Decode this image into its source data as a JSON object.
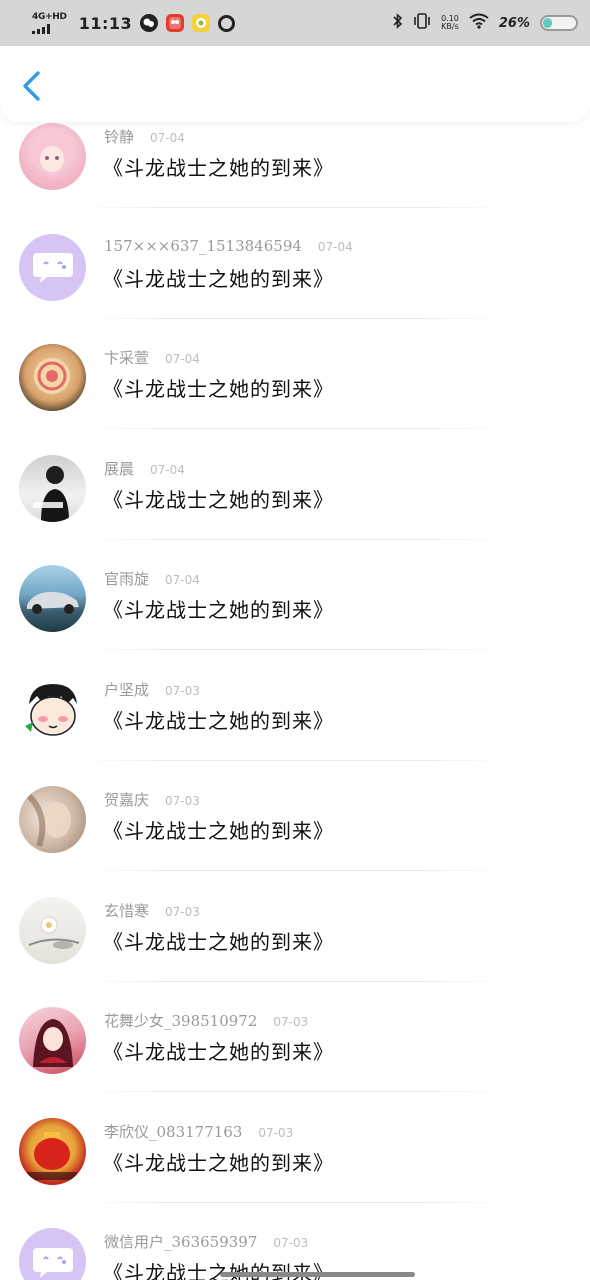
{
  "status_bar": {
    "network": "4G+HD",
    "time": "11:13",
    "net_speed_value": "0.10",
    "net_speed_unit": "KB/s",
    "battery_percent": "26%",
    "battery_level": 0.26,
    "app_icons": [
      "wechat-icon",
      "app-badge-icon",
      "app-yellow-icon",
      "q-icon"
    ]
  },
  "nav": {
    "back_icon": "chevron-left-icon",
    "accent_color": "#2f9be6"
  },
  "rows": [
    {
      "name": "铃静",
      "date": "07-04",
      "title": "《斗龙战士之她的到来》",
      "avatar": "anime-girl-avatar"
    },
    {
      "name": "157×××637_1513846594",
      "date": "07-04",
      "title": "《斗龙战士之她的到来》",
      "avatar": "default-chat-avatar"
    },
    {
      "name": "卞采萱",
      "date": "07-04",
      "title": "《斗龙战士之她的到来》",
      "avatar": "melon-avatar"
    },
    {
      "name": "展晨",
      "date": "07-04",
      "title": "《斗龙战士之她的到来》",
      "avatar": "person-photo-avatar"
    },
    {
      "name": "官雨旋",
      "date": "07-04",
      "title": "《斗龙战士之她的到来》",
      "avatar": "car-avatar"
    },
    {
      "name": "户坚成",
      "date": "07-03",
      "title": "《斗龙战士之她的到来》",
      "avatar": "cartoon-face-avatar"
    },
    {
      "name": "贺嘉庆",
      "date": "07-03",
      "title": "《斗龙战士之她的到来》",
      "avatar": "blurred-face-avatar"
    },
    {
      "name": "玄惜寒",
      "date": "07-03",
      "title": "《斗龙战士之她的到来》",
      "avatar": "flower-avatar"
    },
    {
      "name": "花舞少女_398510972",
      "date": "07-03",
      "title": "《斗龙战士之她的到来》",
      "avatar": "anime-red-avatar"
    },
    {
      "name": "李欣仪_083177163",
      "date": "07-03",
      "title": "《斗龙战士之她的到来》",
      "avatar": "red-lantern-avatar"
    },
    {
      "name": "微信用户_363659397",
      "date": "07-03",
      "title": "《斗龙战士之她的到来》",
      "avatar": "default-chat-avatar"
    }
  ]
}
